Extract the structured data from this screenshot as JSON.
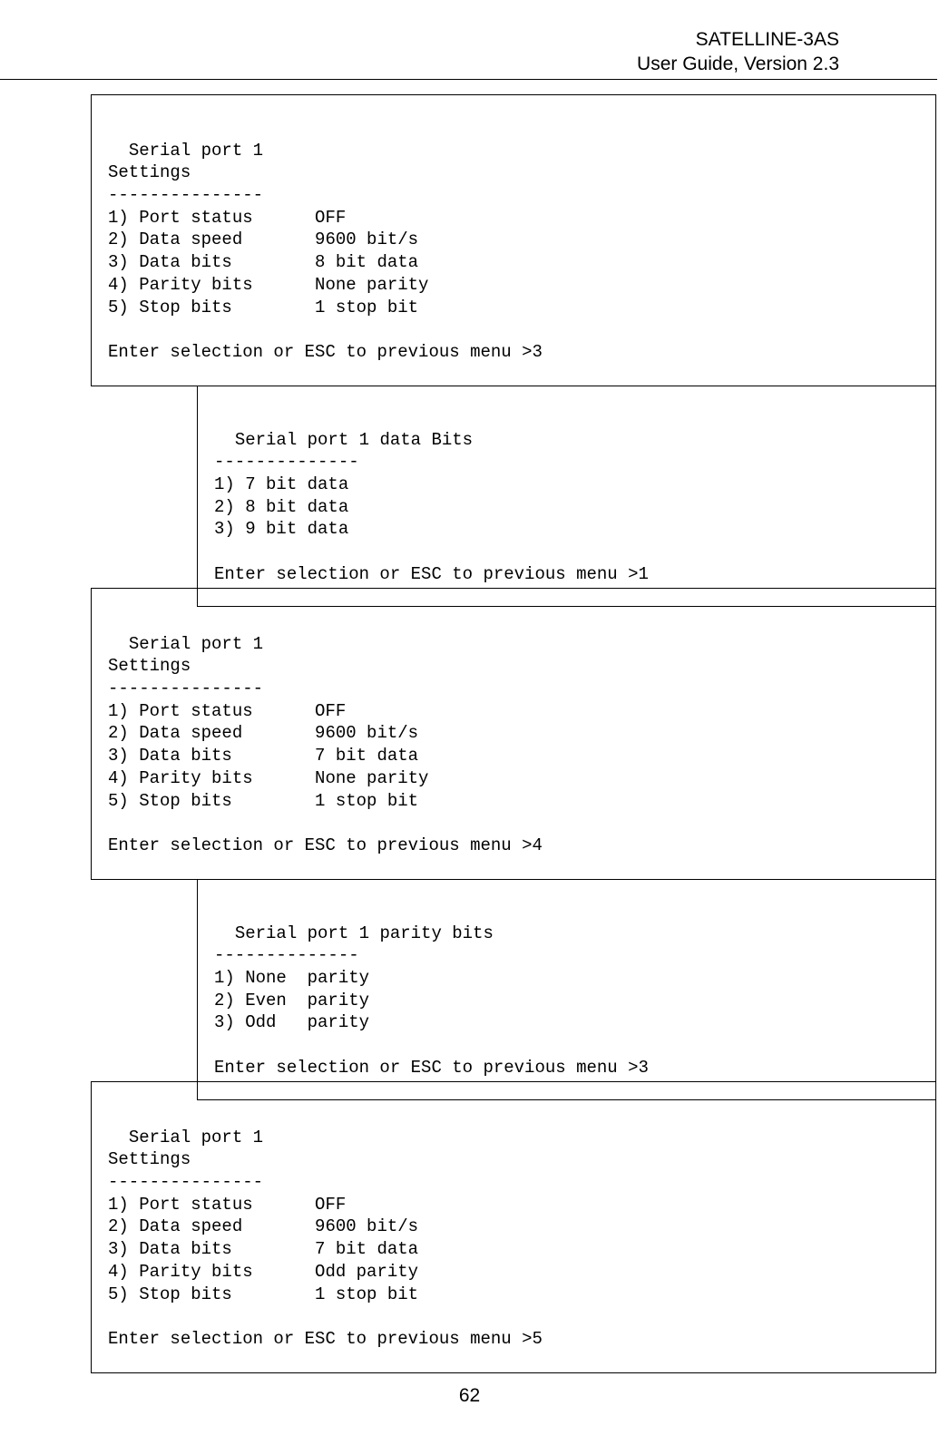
{
  "header": {
    "line1": "SATELLINE-3AS",
    "line2": "User Guide, Version 2.3"
  },
  "box1": {
    "content": "Serial port 1\nSettings\n---------------\n1) Port status      OFF\n2) Data speed       9600 bit/s\n3) Data bits        8 bit data\n4) Parity bits      None parity\n5) Stop bits        1 stop bit\n\nEnter selection or ESC to previous menu >3"
  },
  "box2": {
    "content": "Serial port 1 data Bits\n--------------\n1) 7 bit data\n2) 8 bit data\n3) 9 bit data\n\nEnter selection or ESC to previous menu >1"
  },
  "box3": {
    "content": "Serial port 1\nSettings\n---------------\n1) Port status      OFF\n2) Data speed       9600 bit/s\n3) Data bits        7 bit data\n4) Parity bits      None parity\n5) Stop bits        1 stop bit\n\nEnter selection or ESC to previous menu >4"
  },
  "box4": {
    "content": "Serial port 1 parity bits\n--------------\n1) None  parity\n2) Even  parity\n3) Odd   parity\n\nEnter selection or ESC to previous menu >3"
  },
  "box5": {
    "content": "Serial port 1\nSettings\n---------------\n1) Port status      OFF\n2) Data speed       9600 bit/s\n3) Data bits        7 bit data\n4) Parity bits      Odd parity\n5) Stop bits        1 stop bit\n\nEnter selection or ESC to previous menu >5"
  },
  "pageNumber": "62"
}
